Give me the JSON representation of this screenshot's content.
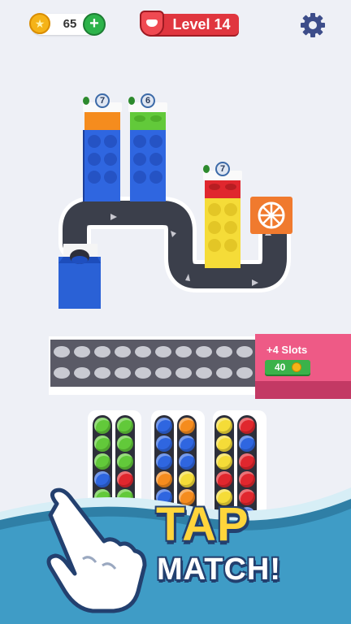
{
  "hud": {
    "coins": "65",
    "level": "Level 14"
  },
  "colors": {
    "blue": "#2f66e0",
    "orange": "#f58c1e",
    "green": "#62c93a",
    "yellow": "#f5dc38",
    "red": "#e0272e",
    "tray": "#5a5a66",
    "pink": "#ee5a86"
  },
  "stacks": [
    {
      "count": "7",
      "head_color": "orange",
      "body_color": "blue"
    },
    {
      "count": "6",
      "head_color": "green",
      "body_color": "blue"
    },
    {
      "count": "7",
      "head_color": "red",
      "body_color": "yellow"
    }
  ],
  "tray": {
    "slot_rows": 2,
    "slots_per_row": 10
  },
  "extra_slots": {
    "label": "+4 Slots",
    "price": "40"
  },
  "tubes": [
    [
      "green",
      "green",
      "green",
      "blue",
      "green",
      "green",
      "green",
      "red"
    ],
    [
      "blue",
      "blue",
      "blue",
      "orange",
      "orange",
      "blue",
      "blue",
      "yellow"
    ],
    [
      "yellow",
      "yellow",
      "yellow",
      "red",
      "red",
      "blue",
      "red",
      "red"
    ]
  ],
  "promo": {
    "line1": "TAP",
    "line2": "MATCH!"
  }
}
